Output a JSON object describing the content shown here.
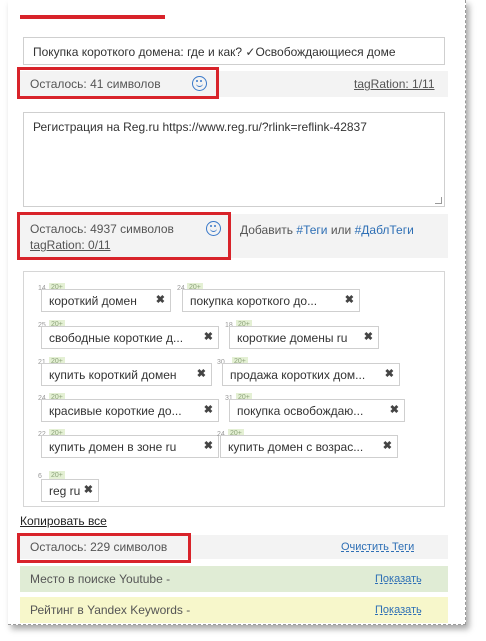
{
  "title_input": {
    "value": "Покупка короткого домена: где и как? ✓Освобождающиеся доме"
  },
  "title_counter": {
    "label": "Осталось: 41 символов",
    "tag_ration": "tagRation: 1/11"
  },
  "description": {
    "value": "Регистрация на Reg.ru https://www.reg.ru/?rlink=reflink-42837"
  },
  "description_counter": {
    "label": "Осталось: 4937 символов",
    "tag_ration": "tagRation: 0/11"
  },
  "add_tags": {
    "prefix": "Добавить",
    "tags_link": "#Теги",
    "or": "или",
    "double_tags_link": "#ДаблТеги"
  },
  "tags": [
    {
      "label": "короткий домен",
      "num": "14",
      "badge": "20+"
    },
    {
      "label": "покупка короткого до...",
      "num": "24",
      "badge": "20+"
    },
    {
      "label": "свободные короткие д...",
      "num": "25",
      "badge": "20+"
    },
    {
      "label": "короткие домены ru",
      "num": "18",
      "badge": "20+"
    },
    {
      "label": "купить короткий домен",
      "num": "21",
      "badge": "20+"
    },
    {
      "label": "продажа коротких дом...",
      "num": "30",
      "badge": "20+"
    },
    {
      "label": "красивые короткие до...",
      "num": "24",
      "badge": "20+"
    },
    {
      "label": "покупка освобождаю...",
      "num": "31",
      "badge": "20+"
    },
    {
      "label": "купить домен в зоне ru",
      "num": "22",
      "badge": "20+"
    },
    {
      "label": "купить домен с возрас...",
      "num": "24",
      "badge": "20+"
    },
    {
      "label": "reg ru",
      "num": "6",
      "badge": "20+"
    }
  ],
  "tag_remove_symbol": "✖",
  "copy_all": "Копировать все",
  "tags_counter": {
    "label": "Осталось: 229 символов",
    "clear": "Очистить Теги"
  },
  "youtube_row": {
    "label": "Место в поиске Youtube -",
    "action": "Показать"
  },
  "yandex_row": {
    "label": "Рейтинг в Yandex Keywords -",
    "action": "Показать"
  },
  "colors": {
    "accent_red": "#d8232a",
    "link_blue": "#2e6fb5",
    "green_row": "#e0ecd5",
    "yellow_row": "#f7f7cb"
  }
}
